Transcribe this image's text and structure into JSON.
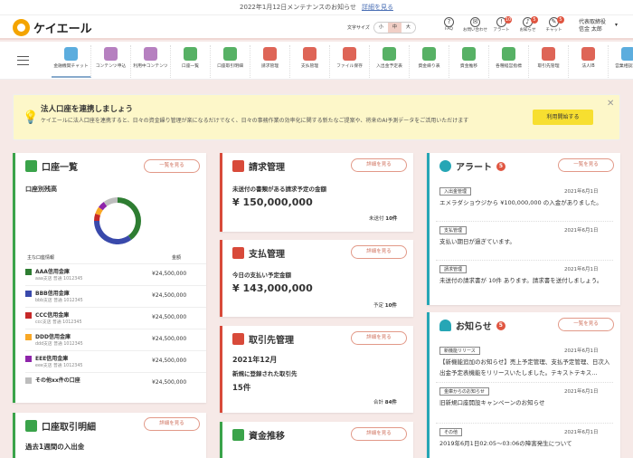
{
  "notice": {
    "text": "2022年1月12日メンテナンスのお知らせ",
    "link": "詳細を見る"
  },
  "app": {
    "name": "ケイエール"
  },
  "fontsize": {
    "label": "文字サイズ",
    "small": "小",
    "mid": "中",
    "large": "大"
  },
  "header_icons": [
    {
      "label": "FAQ",
      "icon": "question-icon",
      "badge": ""
    },
    {
      "label": "お問い合わせ",
      "icon": "mail-icon",
      "badge": ""
    },
    {
      "label": "アラート",
      "icon": "alert-icon",
      "badge": "10"
    },
    {
      "label": "お知らせ",
      "icon": "bell-icon",
      "badge": "5"
    },
    {
      "label": "チャット",
      "icon": "chat-icon",
      "badge": "5"
    }
  ],
  "user": {
    "line1": "代表取締役",
    "line2": "信金 太郎"
  },
  "menu": [
    "金融機関チャット",
    "コンテンツ申込",
    "利用中コンテンツ",
    "口座一覧",
    "口座取引明細",
    "請求管理",
    "支払管理",
    "ファイル保存",
    "入出金予定表",
    "資金繰り表",
    "資金推移",
    "各種経営指標",
    "取引先管理",
    "法人IB",
    "営業相談窓口"
  ],
  "menu_colors": [
    "#3f9fd8",
    "#a96ab5",
    "#a96ab5",
    "#3aa34a",
    "#3aa34a",
    "#d84a3a",
    "#d84a3a",
    "#d84a3a",
    "#3aa34a",
    "#3aa34a",
    "#3aa34a",
    "#3aa34a",
    "#d84a3a",
    "#d84a3a",
    "#3f9fd8"
  ],
  "banner": {
    "title": "法人口座を連携しましょう",
    "body": "ケイエールに法人口座を連携すると、日々の資金繰り管理が楽になるだけでなく、日々の事務作業の効率化に関する新たなご提案や、将来のAI予測データをご活用いただけます",
    "cta": "利用開始する"
  },
  "accounts": {
    "title": "口座一覧",
    "more": "一覧を見る",
    "subtitle": "口座別残高",
    "col_name": "主な口座情報",
    "col_amount": "金額",
    "rows": [
      {
        "name": "AAA信用金庫",
        "sub": "aaa支店 普通 1012345",
        "amount": "¥24,500,000",
        "color": "#2e7d32"
      },
      {
        "name": "BBB信用金庫",
        "sub": "bbb支店 普通 1012345",
        "amount": "¥24,500,000",
        "color": "#3949ab"
      },
      {
        "name": "CCC信用金庫",
        "sub": "ccc支店 普通 1012345",
        "amount": "¥24,500,000",
        "color": "#c62828"
      },
      {
        "name": "DDD信用金庫",
        "sub": "ddd支店 普通 1012345",
        "amount": "¥24,500,000",
        "color": "#f9a825"
      },
      {
        "name": "EEE信用金庫",
        "sub": "eee支店 普通 1012345",
        "amount": "¥24,500,000",
        "color": "#8e24aa"
      },
      {
        "name": "その他xx件の口座",
        "sub": "",
        "amount": "¥24,500,000",
        "color": "#bdbdbd"
      }
    ]
  },
  "donut": {
    "values": [
      40,
      35,
      5,
      5,
      5,
      10
    ]
  },
  "transactions": {
    "title": "口座取引明細",
    "more": "詳細を見る",
    "sub": "過去1週間の入出金"
  },
  "billing": {
    "title": "請求管理",
    "more": "詳細を見る",
    "label": "未送付の書類がある請求予定の金額",
    "amount": "¥ 150,000,000",
    "foot_label": "未送付",
    "foot_value": "10件"
  },
  "payment": {
    "title": "支払管理",
    "more": "詳細を見る",
    "label": "今日の支払い予定金額",
    "amount": "¥ 143,000,000",
    "foot_label": "予定",
    "foot_value": "10件"
  },
  "partners": {
    "title": "取引先管理",
    "more": "詳細を見る",
    "month": "2021年12月",
    "label": "新規に登録された取引先",
    "count": "15件",
    "foot_label": "合計",
    "foot_value": "84件"
  },
  "cashflow": {
    "title": "資金推移",
    "more": "詳細を見る"
  },
  "alerts": {
    "title": "アラート",
    "count": "5",
    "more": "一覧を見る",
    "items": [
      {
        "tag": "入出金管理",
        "date": "2021年6月1日",
        "text": "エメラダショウジから ¥100,000,000 の入金がありました。"
      },
      {
        "tag": "支払管理",
        "date": "2021年6月1日",
        "text": "支払い期日が過ぎています。"
      },
      {
        "tag": "請求管理",
        "date": "2021年6月1日",
        "text": "未送付の請求書が 10件 あります。請求書を送付しましょう。"
      }
    ]
  },
  "news": {
    "title": "お知らせ",
    "count": "5",
    "more": "一覧を見る",
    "items": [
      {
        "tag": "新機能リリース",
        "date": "2021年6月1日",
        "text": "【新機能追加のお知らせ】売上予定管理、支払予定管理、日次入出金予定表機能をリリースいたしました。テキストテキス…"
      },
      {
        "tag": "金庫からのお知らせ",
        "date": "2021年6月1日",
        "text": "旧新規口座開設キャンペーンのお知らせ"
      },
      {
        "tag": "その他",
        "date": "2021年6月1日",
        "text": "2019年6月1日02:05〜03:06の障害発生について"
      }
    ]
  }
}
